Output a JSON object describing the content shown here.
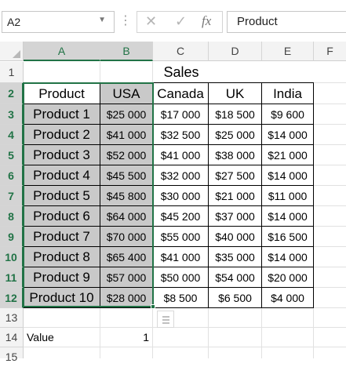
{
  "formula_bar": {
    "name_box": "A2",
    "formula": "Product",
    "fx": "fx"
  },
  "columns": [
    "A",
    "B",
    "C",
    "D",
    "E",
    "F"
  ],
  "rows": [
    "1",
    "2",
    "3",
    "4",
    "5",
    "6",
    "7",
    "8",
    "9",
    "10",
    "11",
    "12",
    "13",
    "14",
    "15"
  ],
  "sheet": {
    "title": "Sales",
    "headers": [
      "Product",
      "USA",
      "Canada",
      "UK",
      "India"
    ],
    "data": [
      [
        "Product 1",
        "$25 000",
        "$17 000",
        "$18 500",
        "$9 600"
      ],
      [
        "Product 2",
        "$41 000",
        "$32 500",
        "$25 000",
        "$14 000"
      ],
      [
        "Product 3",
        "$52 000",
        "$41 000",
        "$38 000",
        "$21 000"
      ],
      [
        "Product 4",
        "$45 500",
        "$32 000",
        "$27 500",
        "$14 000"
      ],
      [
        "Product 5",
        "$45 800",
        "$30 000",
        "$21 000",
        "$11 000"
      ],
      [
        "Product 6",
        "$64 000",
        "$45 200",
        "$37 000",
        "$14 000"
      ],
      [
        "Product 7",
        "$70 000",
        "$55 000",
        "$40 000",
        "$16 500"
      ],
      [
        "Product 8",
        "$65 400",
        "$41 000",
        "$35 000",
        "$14 000"
      ],
      [
        "Product 9",
        "$57 000",
        "$50 000",
        "$54 000",
        "$20 000"
      ],
      [
        "Product 10",
        "$28 000",
        "$8 500",
        "$6 500",
        "$4 000"
      ]
    ],
    "value_label": "Value",
    "value": "1"
  },
  "selection": {
    "active_cell": "A2",
    "range": "A2:B12",
    "selected_columns": [
      "A",
      "B"
    ]
  },
  "colors": {
    "accent": "#217346",
    "header_bg": "#f3f3f3",
    "grey_fill": "#c9c9c9"
  }
}
